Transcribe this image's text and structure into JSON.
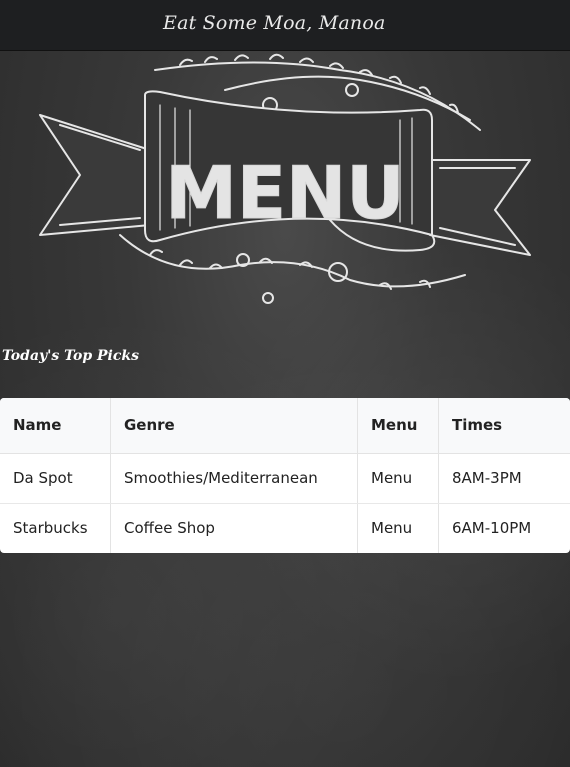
{
  "navbar": {
    "brand": "Eat Some Moa, Manoa"
  },
  "hero": {
    "banner_text": "MENU"
  },
  "section": {
    "title": "Today's Top Picks"
  },
  "table": {
    "headers": [
      "Name",
      "Genre",
      "Menu",
      "Times"
    ],
    "rows": [
      [
        "Da Spot",
        "Smoothies/Mediterranean",
        "Menu",
        "8AM-3PM"
      ],
      [
        "Starbucks",
        "Coffee Shop",
        "Menu",
        "6AM-10PM"
      ]
    ]
  }
}
